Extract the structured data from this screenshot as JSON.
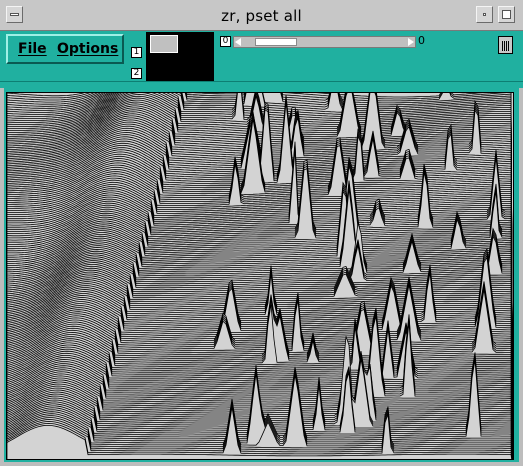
{
  "window": {
    "title": "zr, pset all"
  },
  "menu": {
    "file_label": "File",
    "options_label": "Options"
  },
  "panel": {
    "layer_buttons": [
      {
        "label": "0"
      },
      {
        "label": "1"
      },
      {
        "label": "2"
      }
    ],
    "slider": {
      "value_label": "0",
      "position": 0.1
    }
  },
  "colors": {
    "panel": "#20b0a0",
    "plot_bg": "#d3d3d3",
    "lines": "#000000"
  },
  "icons": [
    "window-menu-icon",
    "minimize-icon",
    "maximize-icon",
    "slider-left-arrow-icon",
    "slider-right-arrow-icon",
    "lock-icon"
  ]
}
